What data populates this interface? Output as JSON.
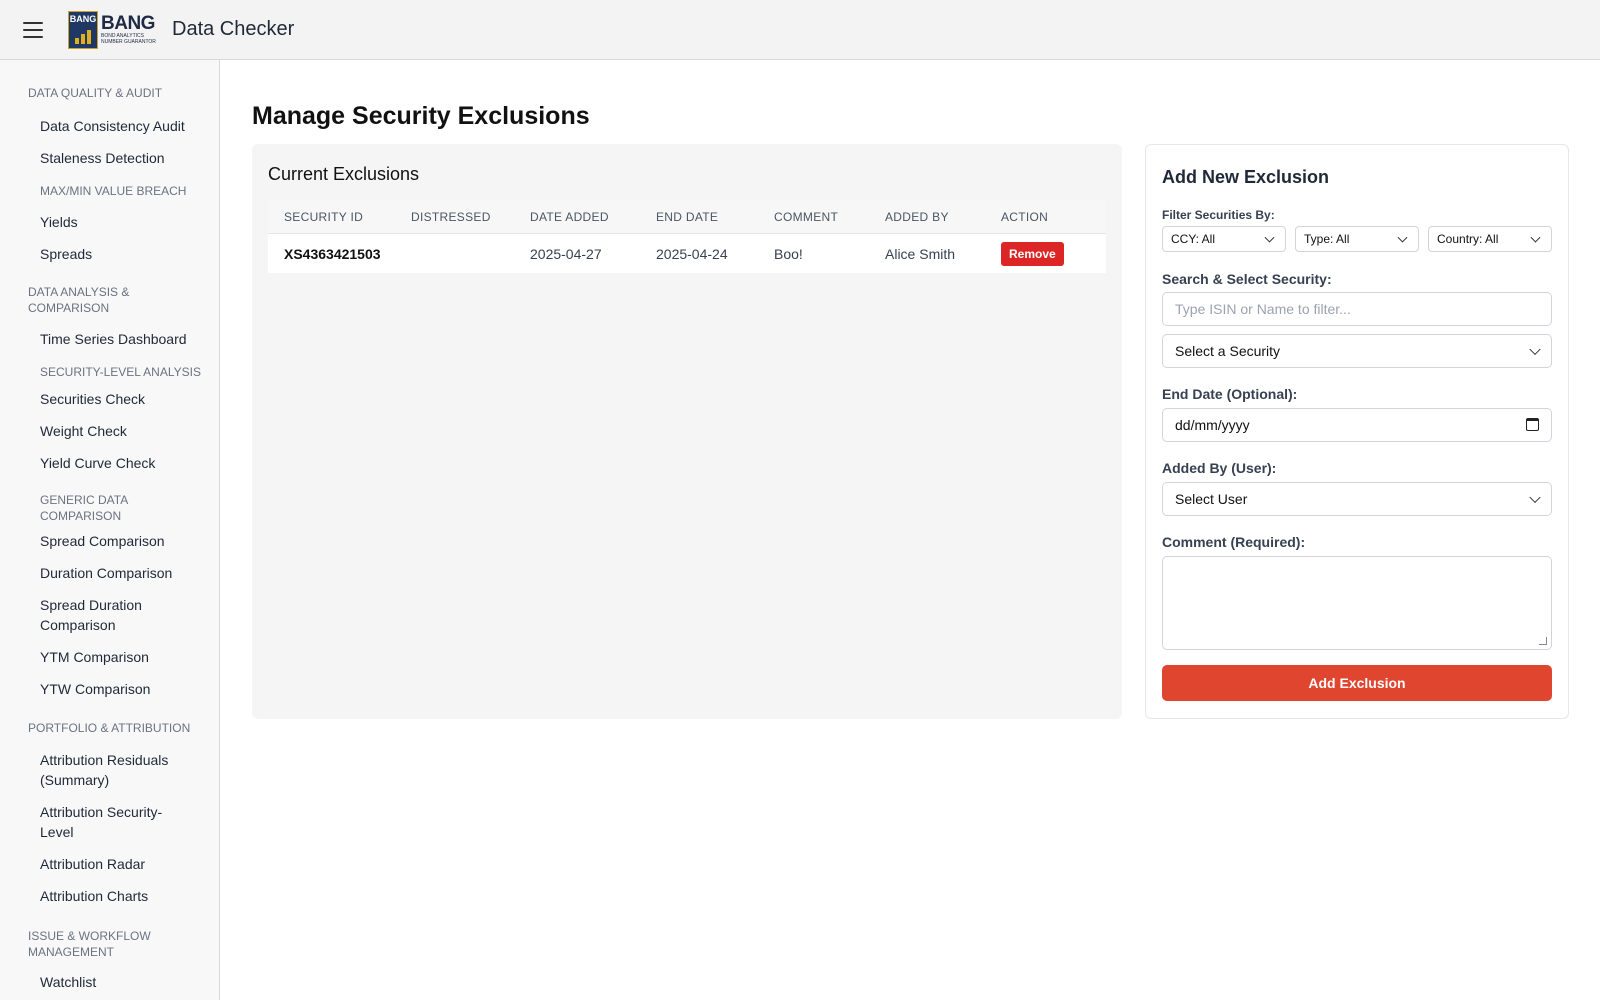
{
  "header": {
    "logo_badge": "BANG",
    "logo_word": "BANG",
    "logo_tagline_1": "BOND ANALYTICS",
    "logo_tagline_2": "NUMBER GUARANTOR",
    "app_title": "Data Checker"
  },
  "sidebar": {
    "s1": "DATA QUALITY & AUDIT",
    "i1": "Data Consistency Audit",
    "i2": "Staleness Detection",
    "s2": "MAX/MIN VALUE BREACH",
    "i3": "Yields",
    "i4": "Spreads",
    "s3a": "DATA ANALYSIS &",
    "s3b": "COMPARISON",
    "i5": "Time Series Dashboard",
    "s4": "SECURITY-LEVEL ANALYSIS",
    "i6": "Securities Check",
    "i7": "Weight Check",
    "i8": "Yield Curve Check",
    "s5a": "GENERIC DATA",
    "s5b": "COMPARISON",
    "i9": "Spread Comparison",
    "i10": "Duration Comparison",
    "i11a": "Spread Duration",
    "i11b": "Comparison",
    "i12": "YTM Comparison",
    "i13": "YTW Comparison",
    "s6": "PORTFOLIO & ATTRIBUTION",
    "i14a": "Attribution Residuals",
    "i14b": "(Summary)",
    "i15a": "Attribution Security-",
    "i15b": "Level",
    "i16": "Attribution Radar",
    "i17": "Attribution Charts",
    "s7a": "ISSUE & WORKFLOW",
    "s7b": "MANAGEMENT",
    "i18": "Watchlist"
  },
  "main": {
    "title": "Manage Security Exclusions"
  },
  "exclusions": {
    "heading": "Current Exclusions",
    "columns": [
      "SECURITY ID",
      "DISTRESSED",
      "DATE ADDED",
      "END DATE",
      "COMMENT",
      "ADDED BY",
      "ACTION"
    ],
    "rows": [
      {
        "security_id": "XS4363421503",
        "distressed": "",
        "date_added": "2025-04-27",
        "end_date": "2025-04-24",
        "comment": "Boo!",
        "added_by": "Alice Smith",
        "action": "Remove"
      }
    ]
  },
  "form": {
    "heading": "Add New Exclusion",
    "filter_label": "Filter Securities By:",
    "filter_ccy": "CCY: All",
    "filter_type": "Type: All",
    "filter_country": "Country: All",
    "search_label": "Search & Select Security:",
    "search_placeholder": "Type ISIN or Name to filter...",
    "security_select": "Select a Security",
    "end_date_label": "End Date (Optional):",
    "end_date_value": "dd/mm/yyyy",
    "added_by_label": "Added By (User):",
    "user_select": "Select User",
    "comment_label": "Comment (Required):",
    "submit": "Add Exclusion"
  },
  "colors": {
    "remove_button": "#dc2626",
    "add_button": "#e04530"
  }
}
